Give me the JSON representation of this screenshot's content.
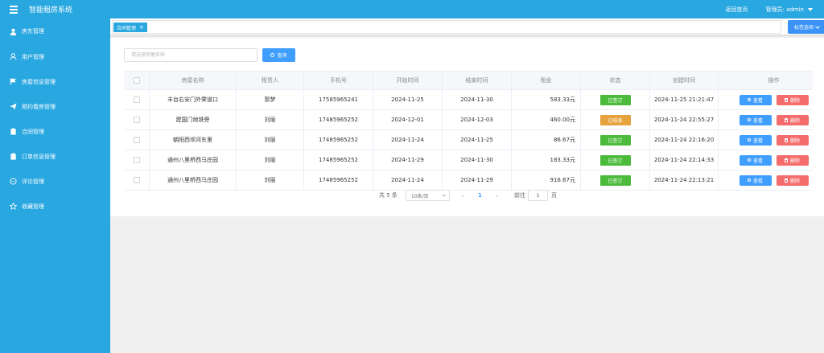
{
  "app": {
    "title": "智能租房系统",
    "back_home": "返回首页",
    "admin_label": "管理员: admin"
  },
  "sidebar": {
    "items": [
      {
        "label": "房东管理",
        "icon": "user-icon"
      },
      {
        "label": "用户管理",
        "icon": "person-icon"
      },
      {
        "label": "房屋信息管理",
        "icon": "flag-icon"
      },
      {
        "label": "预约看房管理",
        "icon": "send-icon"
      },
      {
        "label": "合同管理",
        "icon": "clipboard-icon"
      },
      {
        "label": "订单信息管理",
        "icon": "clipboard-icon"
      },
      {
        "label": "评论管理",
        "icon": "chat-icon"
      },
      {
        "label": "收藏管理",
        "icon": "star-icon"
      }
    ]
  },
  "tabs": {
    "active_label": "合同管理",
    "close_symbol": "×",
    "options_label": "标签选项"
  },
  "search": {
    "placeholder": "请选择房屋名称",
    "button_label": "查询"
  },
  "table": {
    "columns": [
      "房屋名称",
      "租赁人",
      "手机号",
      "开始时间",
      "结束时间",
      "租金",
      "状态",
      "创建时间",
      "操作"
    ],
    "view_label": "查看",
    "delete_label": "删除",
    "rows": [
      {
        "name": "丰台右安门外霁道口",
        "tenant": "郭梦",
        "phone": "17585965241",
        "start": "2024-11-25",
        "end": "2024-11-30",
        "rent": "583.33元",
        "status": "已签订",
        "status_type": "signed",
        "created": "2024-11-25 21:21:47"
      },
      {
        "name": "建国门地铁旁",
        "tenant": "刘丽",
        "phone": "17485965252",
        "start": "2024-12-01",
        "end": "2024-12-03",
        "rent": "460.00元",
        "status": "已结束",
        "status_type": "ended",
        "created": "2024-11-24 22:55:27"
      },
      {
        "name": "朝阳西坝河东里",
        "tenant": "刘丽",
        "phone": "17485965252",
        "start": "2024-11-24",
        "end": "2024-11-25",
        "rent": "86.67元",
        "status": "已签订",
        "status_type": "signed",
        "created": "2024-11-24 22:16:20"
      },
      {
        "name": "通州八里桥西马庄园",
        "tenant": "刘丽",
        "phone": "17485965252",
        "start": "2024-11-29",
        "end": "2024-11-30",
        "rent": "183.33元",
        "status": "已签订",
        "status_type": "signed",
        "created": "2024-11-24 22:14:33"
      },
      {
        "name": "通州八里桥西马庄园",
        "tenant": "刘丽",
        "phone": "17485965252",
        "start": "2024-11-24",
        "end": "2024-11-29",
        "rent": "916.67元",
        "status": "已签订",
        "status_type": "signed",
        "created": "2024-11-24 22:13:21"
      }
    ]
  },
  "pagination": {
    "total": "共 5 条",
    "page_size": "10条/页",
    "prev": "‹",
    "current": "1",
    "next": "›",
    "goto_label": "前往",
    "goto_value": "1",
    "page_suffix": "页"
  },
  "colors": {
    "primary": "#29a7e1",
    "button_blue": "#409eff",
    "danger": "#f56c6c",
    "success": "#4cbb3c",
    "warning": "#e6a23c"
  }
}
